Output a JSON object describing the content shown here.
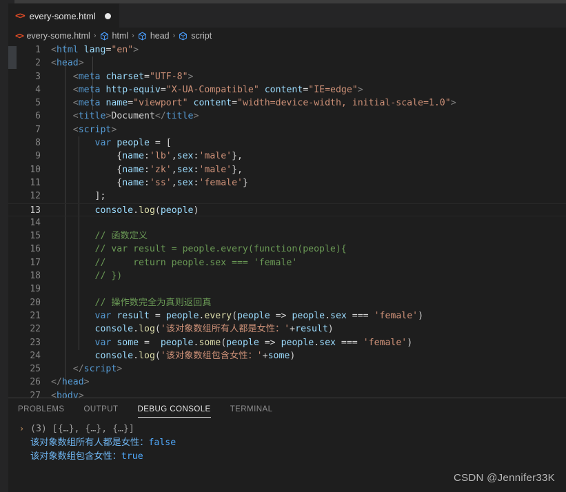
{
  "window": {
    "accent_html_icon_color": "#e44d26",
    "accent_tag_color": "#569cd6",
    "background": "#1e1e1e"
  },
  "tab": {
    "icon": "html-file-icon",
    "label": "every-some.html",
    "dirty_indicator": "●"
  },
  "breadcrumb": {
    "separator": "›",
    "items": [
      {
        "icon": "html-file-icon",
        "label": "every-some.html"
      },
      {
        "icon": "element-cube-icon",
        "label": "html"
      },
      {
        "icon": "element-cube-icon",
        "label": "head"
      },
      {
        "icon": "element-cube-icon",
        "label": "script"
      }
    ]
  },
  "editor": {
    "active_line": 13,
    "lines": [
      {
        "n": "1",
        "tokens": [
          {
            "c": "t-punct",
            "t": "<"
          },
          {
            "c": "t-tag",
            "t": "html"
          },
          {
            "c": "t-plain",
            "t": " "
          },
          {
            "c": "t-attr",
            "t": "lang"
          },
          {
            "c": "t-plain",
            "t": "="
          },
          {
            "c": "t-str",
            "t": "\"en\""
          },
          {
            "c": "t-punct",
            "t": ">"
          }
        ]
      },
      {
        "n": "2",
        "tokens": [
          {
            "c": "t-punct",
            "t": "<"
          },
          {
            "c": "t-tag",
            "t": "head"
          },
          {
            "c": "t-punct",
            "t": ">"
          }
        ]
      },
      {
        "n": "3",
        "tokens": [
          {
            "c": "t-plain",
            "t": "    "
          },
          {
            "c": "t-punct",
            "t": "<"
          },
          {
            "c": "t-tag",
            "t": "meta"
          },
          {
            "c": "t-plain",
            "t": " "
          },
          {
            "c": "t-attr",
            "t": "charset"
          },
          {
            "c": "t-plain",
            "t": "="
          },
          {
            "c": "t-str",
            "t": "\"UTF-8\""
          },
          {
            "c": "t-punct",
            "t": ">"
          }
        ]
      },
      {
        "n": "4",
        "tokens": [
          {
            "c": "t-plain",
            "t": "    "
          },
          {
            "c": "t-punct",
            "t": "<"
          },
          {
            "c": "t-tag",
            "t": "meta"
          },
          {
            "c": "t-plain",
            "t": " "
          },
          {
            "c": "t-attr",
            "t": "http-equiv"
          },
          {
            "c": "t-plain",
            "t": "="
          },
          {
            "c": "t-str",
            "t": "\"X-UA-Compatible\""
          },
          {
            "c": "t-plain",
            "t": " "
          },
          {
            "c": "t-attr",
            "t": "content"
          },
          {
            "c": "t-plain",
            "t": "="
          },
          {
            "c": "t-str",
            "t": "\"IE=edge\""
          },
          {
            "c": "t-punct",
            "t": ">"
          }
        ]
      },
      {
        "n": "5",
        "tokens": [
          {
            "c": "t-plain",
            "t": "    "
          },
          {
            "c": "t-punct",
            "t": "<"
          },
          {
            "c": "t-tag",
            "t": "meta"
          },
          {
            "c": "t-plain",
            "t": " "
          },
          {
            "c": "t-attr",
            "t": "name"
          },
          {
            "c": "t-plain",
            "t": "="
          },
          {
            "c": "t-str",
            "t": "\"viewport\""
          },
          {
            "c": "t-plain",
            "t": " "
          },
          {
            "c": "t-attr",
            "t": "content"
          },
          {
            "c": "t-plain",
            "t": "="
          },
          {
            "c": "t-str",
            "t": "\"width=device-width, initial-scale=1.0\""
          },
          {
            "c": "t-punct",
            "t": ">"
          }
        ]
      },
      {
        "n": "6",
        "tokens": [
          {
            "c": "t-plain",
            "t": "    "
          },
          {
            "c": "t-punct",
            "t": "<"
          },
          {
            "c": "t-tag",
            "t": "title"
          },
          {
            "c": "t-punct",
            "t": ">"
          },
          {
            "c": "t-plain",
            "t": "Document"
          },
          {
            "c": "t-punct",
            "t": "</"
          },
          {
            "c": "t-tag",
            "t": "title"
          },
          {
            "c": "t-punct",
            "t": ">"
          }
        ]
      },
      {
        "n": "7",
        "tokens": [
          {
            "c": "t-plain",
            "t": "    "
          },
          {
            "c": "t-punct",
            "t": "<"
          },
          {
            "c": "t-tag",
            "t": "script"
          },
          {
            "c": "t-punct",
            "t": ">"
          }
        ]
      },
      {
        "n": "8",
        "tokens": [
          {
            "c": "t-plain",
            "t": "        "
          },
          {
            "c": "t-kw",
            "t": "var"
          },
          {
            "c": "t-plain",
            "t": " "
          },
          {
            "c": "t-var",
            "t": "people"
          },
          {
            "c": "t-plain",
            "t": " = ["
          }
        ]
      },
      {
        "n": "9",
        "tokens": [
          {
            "c": "t-plain",
            "t": "            {"
          },
          {
            "c": "t-var",
            "t": "name"
          },
          {
            "c": "t-plain",
            "t": ":"
          },
          {
            "c": "t-str",
            "t": "'lb'"
          },
          {
            "c": "t-plain",
            "t": ","
          },
          {
            "c": "t-var",
            "t": "sex"
          },
          {
            "c": "t-plain",
            "t": ":"
          },
          {
            "c": "t-str",
            "t": "'male'"
          },
          {
            "c": "t-plain",
            "t": "},"
          }
        ]
      },
      {
        "n": "10",
        "tokens": [
          {
            "c": "t-plain",
            "t": "            {"
          },
          {
            "c": "t-var",
            "t": "name"
          },
          {
            "c": "t-plain",
            "t": ":"
          },
          {
            "c": "t-str",
            "t": "'zk'"
          },
          {
            "c": "t-plain",
            "t": ","
          },
          {
            "c": "t-var",
            "t": "sex"
          },
          {
            "c": "t-plain",
            "t": ":"
          },
          {
            "c": "t-str",
            "t": "'male'"
          },
          {
            "c": "t-plain",
            "t": "},"
          }
        ]
      },
      {
        "n": "11",
        "tokens": [
          {
            "c": "t-plain",
            "t": "            {"
          },
          {
            "c": "t-var",
            "t": "name"
          },
          {
            "c": "t-plain",
            "t": ":"
          },
          {
            "c": "t-str",
            "t": "'ss'"
          },
          {
            "c": "t-plain",
            "t": ","
          },
          {
            "c": "t-var",
            "t": "sex"
          },
          {
            "c": "t-plain",
            "t": ":"
          },
          {
            "c": "t-str",
            "t": "'female'"
          },
          {
            "c": "t-plain",
            "t": "}"
          }
        ]
      },
      {
        "n": "12",
        "tokens": [
          {
            "c": "t-plain",
            "t": "        ];"
          }
        ]
      },
      {
        "n": "13",
        "tokens": [
          {
            "c": "t-plain",
            "t": "        "
          },
          {
            "c": "t-var",
            "t": "console"
          },
          {
            "c": "t-plain",
            "t": "."
          },
          {
            "c": "t-func",
            "t": "log"
          },
          {
            "c": "t-plain",
            "t": "("
          },
          {
            "c": "t-var",
            "t": "people"
          },
          {
            "c": "t-plain",
            "t": ")"
          }
        ]
      },
      {
        "n": "14",
        "tokens": []
      },
      {
        "n": "15",
        "tokens": [
          {
            "c": "t-plain",
            "t": "        "
          },
          {
            "c": "t-comment",
            "t": "// 函数定义"
          }
        ]
      },
      {
        "n": "16",
        "tokens": [
          {
            "c": "t-plain",
            "t": "        "
          },
          {
            "c": "t-comment",
            "t": "// var result = people.every(function(people){"
          }
        ]
      },
      {
        "n": "17",
        "tokens": [
          {
            "c": "t-plain",
            "t": "        "
          },
          {
            "c": "t-comment",
            "t": "//     return people.sex === 'female'"
          }
        ]
      },
      {
        "n": "18",
        "tokens": [
          {
            "c": "t-plain",
            "t": "        "
          },
          {
            "c": "t-comment",
            "t": "// })"
          }
        ]
      },
      {
        "n": "19",
        "tokens": []
      },
      {
        "n": "20",
        "tokens": [
          {
            "c": "t-plain",
            "t": "        "
          },
          {
            "c": "t-comment",
            "t": "// 操作数完全为真则返回真"
          }
        ]
      },
      {
        "n": "21",
        "tokens": [
          {
            "c": "t-plain",
            "t": "        "
          },
          {
            "c": "t-kw",
            "t": "var"
          },
          {
            "c": "t-plain",
            "t": " "
          },
          {
            "c": "t-var",
            "t": "result"
          },
          {
            "c": "t-plain",
            "t": " = "
          },
          {
            "c": "t-var",
            "t": "people"
          },
          {
            "c": "t-plain",
            "t": "."
          },
          {
            "c": "t-func",
            "t": "every"
          },
          {
            "c": "t-plain",
            "t": "("
          },
          {
            "c": "t-var",
            "t": "people"
          },
          {
            "c": "t-plain",
            "t": " => "
          },
          {
            "c": "t-var",
            "t": "people"
          },
          {
            "c": "t-plain",
            "t": "."
          },
          {
            "c": "t-var",
            "t": "sex"
          },
          {
            "c": "t-plain",
            "t": " === "
          },
          {
            "c": "t-str",
            "t": "'female'"
          },
          {
            "c": "t-plain",
            "t": ")"
          }
        ]
      },
      {
        "n": "22",
        "tokens": [
          {
            "c": "t-plain",
            "t": "        "
          },
          {
            "c": "t-var",
            "t": "console"
          },
          {
            "c": "t-plain",
            "t": "."
          },
          {
            "c": "t-func",
            "t": "log"
          },
          {
            "c": "t-plain",
            "t": "("
          },
          {
            "c": "t-str",
            "t": "'该对象数组所有人都是女性：'"
          },
          {
            "c": "t-plain",
            "t": "+"
          },
          {
            "c": "t-var",
            "t": "result"
          },
          {
            "c": "t-plain",
            "t": ")"
          }
        ]
      },
      {
        "n": "23",
        "tokens": [
          {
            "c": "t-plain",
            "t": "        "
          },
          {
            "c": "t-kw",
            "t": "var"
          },
          {
            "c": "t-plain",
            "t": " "
          },
          {
            "c": "t-var",
            "t": "some"
          },
          {
            "c": "t-plain",
            "t": " =  "
          },
          {
            "c": "t-var",
            "t": "people"
          },
          {
            "c": "t-plain",
            "t": "."
          },
          {
            "c": "t-func",
            "t": "some"
          },
          {
            "c": "t-plain",
            "t": "("
          },
          {
            "c": "t-var",
            "t": "people"
          },
          {
            "c": "t-plain",
            "t": " => "
          },
          {
            "c": "t-var",
            "t": "people"
          },
          {
            "c": "t-plain",
            "t": "."
          },
          {
            "c": "t-var",
            "t": "sex"
          },
          {
            "c": "t-plain",
            "t": " === "
          },
          {
            "c": "t-str",
            "t": "'female'"
          },
          {
            "c": "t-plain",
            "t": ")"
          }
        ]
      },
      {
        "n": "24",
        "tokens": [
          {
            "c": "t-plain",
            "t": "        "
          },
          {
            "c": "t-var",
            "t": "console"
          },
          {
            "c": "t-plain",
            "t": "."
          },
          {
            "c": "t-func",
            "t": "log"
          },
          {
            "c": "t-plain",
            "t": "("
          },
          {
            "c": "t-str",
            "t": "'该对象数组包含女性：'"
          },
          {
            "c": "t-plain",
            "t": "+"
          },
          {
            "c": "t-var",
            "t": "some"
          },
          {
            "c": "t-plain",
            "t": ")"
          }
        ]
      },
      {
        "n": "25",
        "tokens": [
          {
            "c": "t-plain",
            "t": "    "
          },
          {
            "c": "t-punct",
            "t": "</"
          },
          {
            "c": "t-tag",
            "t": "script"
          },
          {
            "c": "t-punct",
            "t": ">"
          }
        ]
      },
      {
        "n": "26",
        "tokens": [
          {
            "c": "t-punct",
            "t": "</"
          },
          {
            "c": "t-tag",
            "t": "head"
          },
          {
            "c": "t-punct",
            "t": ">"
          }
        ]
      },
      {
        "n": "27",
        "tokens": [
          {
            "c": "t-punct",
            "t": "<"
          },
          {
            "c": "t-tag",
            "t": "body"
          },
          {
            "c": "t-punct",
            "t": ">"
          }
        ]
      }
    ]
  },
  "panel": {
    "tabs": [
      {
        "label": "PROBLEMS",
        "selected": false
      },
      {
        "label": "OUTPUT",
        "selected": false
      },
      {
        "label": "DEBUG CONSOLE",
        "selected": true
      },
      {
        "label": "TERMINAL",
        "selected": false
      }
    ],
    "console_lines": [
      {
        "expandable": true,
        "arrow": "›",
        "parts": [
          {
            "c": "c-dim",
            "t": "(3) [{…}, {…}, {…}]"
          }
        ]
      },
      {
        "expandable": false,
        "parts": [
          {
            "c": "c-blue",
            "t": "该对象数组所有人都是女性："
          },
          {
            "c": "c-val",
            "t": "false"
          }
        ]
      },
      {
        "expandable": false,
        "parts": [
          {
            "c": "c-blue",
            "t": "该对象数组包含女性："
          },
          {
            "c": "c-val",
            "t": "true"
          }
        ]
      }
    ]
  },
  "watermark": {
    "text": "CSDN @Jennifer33K"
  }
}
